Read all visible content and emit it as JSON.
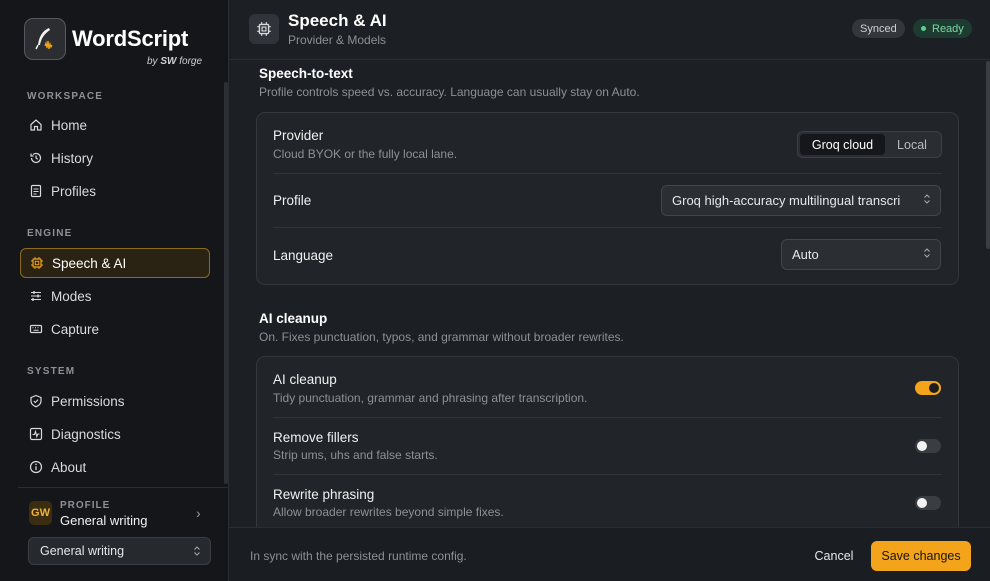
{
  "app": {
    "name": "WordScript",
    "byline_prefix": "by",
    "byline_brand": "SW",
    "byline_suffix": "forge",
    "logo_icon": "quill-waveform-icon"
  },
  "sidebar": {
    "sections": [
      {
        "label": "WORKSPACE",
        "items": [
          {
            "label": "Home",
            "icon": "home-icon"
          },
          {
            "label": "History",
            "icon": "history-icon"
          },
          {
            "label": "Profiles",
            "icon": "profiles-icon"
          }
        ]
      },
      {
        "label": "ENGINE",
        "items": [
          {
            "label": "Speech & AI",
            "icon": "chip-icon",
            "active": true
          },
          {
            "label": "Modes",
            "icon": "sliders-icon"
          },
          {
            "label": "Capture",
            "icon": "keyboard-icon"
          }
        ]
      },
      {
        "label": "SYSTEM",
        "items": [
          {
            "label": "Permissions",
            "icon": "shield-icon"
          },
          {
            "label": "Diagnostics",
            "icon": "pulse-icon"
          },
          {
            "label": "About",
            "icon": "info-icon"
          }
        ]
      }
    ],
    "profile": {
      "badge": "GW",
      "label": "PROFILE",
      "name": "General writing",
      "select_value": "General writing"
    }
  },
  "header": {
    "title": "Speech & AI",
    "subtitle": "Provider & Models",
    "badges": {
      "synced": "Synced",
      "ready": "Ready"
    }
  },
  "speech_to_text": {
    "title": "Speech-to-text",
    "description": "Profile controls speed vs. accuracy. Language can usually stay on Auto.",
    "provider": {
      "label": "Provider",
      "description": "Cloud BYOK or the fully local lane.",
      "options": [
        "Groq cloud",
        "Local"
      ],
      "selected": "Groq cloud"
    },
    "profile": {
      "label": "Profile",
      "value": "Groq high-accuracy multilingual transcri"
    },
    "language": {
      "label": "Language",
      "value": "Auto"
    }
  },
  "ai_cleanup": {
    "title": "AI cleanup",
    "description": "On. Fixes punctuation, typos, and grammar without broader rewrites.",
    "rows": [
      {
        "label": "AI cleanup",
        "description": "Tidy punctuation, grammar and phrasing after transcription.",
        "on": true
      },
      {
        "label": "Remove fillers",
        "description": "Strip ums, uhs and false starts.",
        "on": false
      },
      {
        "label": "Rewrite phrasing",
        "description": "Allow broader rewrites beyond simple fixes.",
        "on": false
      }
    ]
  },
  "footer": {
    "status": "In sync with the persisted runtime config.",
    "cancel_label": "Cancel",
    "save_label": "Save changes"
  },
  "colors": {
    "accent": "#f3a41b",
    "ready": "#5cd08e",
    "background": "#1c1f23",
    "sidebar": "#141619"
  }
}
